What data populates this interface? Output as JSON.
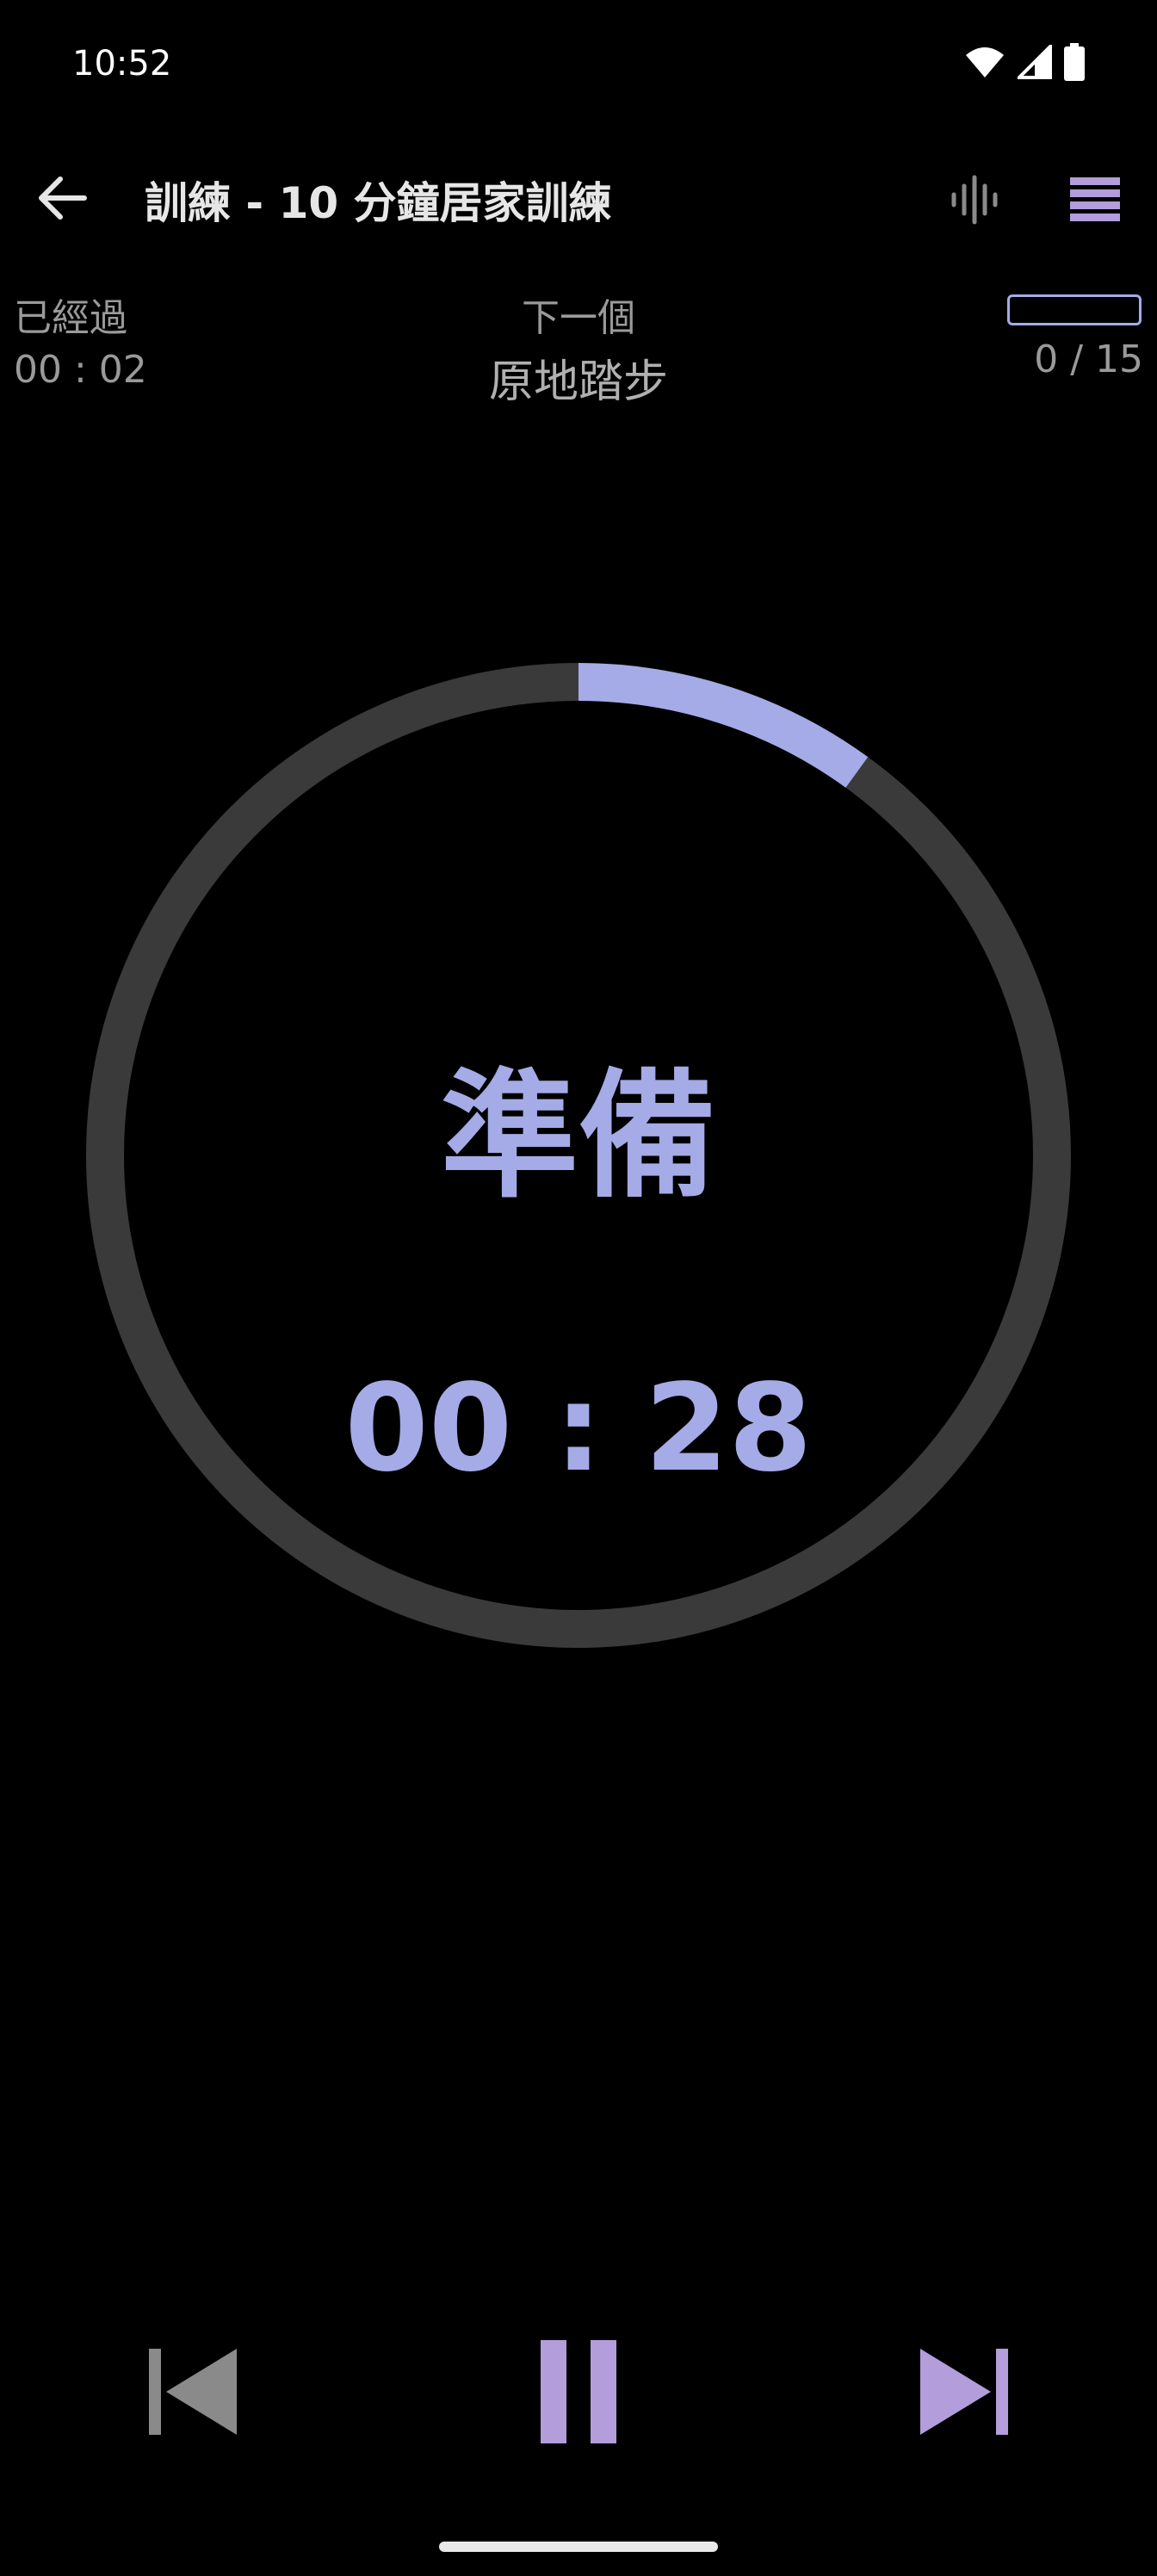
{
  "status_bar": {
    "time": "10:52",
    "icons": [
      "wifi-icon",
      "signal-icon",
      "battery-icon"
    ]
  },
  "app_bar": {
    "title": "訓練 - 10 分鐘居家訓練",
    "icons": [
      "back-arrow-icon",
      "waveform-icon",
      "menu-icon"
    ]
  },
  "info": {
    "elapsed_label": "已經過",
    "elapsed_value": "00 : 02",
    "next_label": "下一個",
    "next_value": "原地踏步",
    "progress_count": "0 / 15",
    "progress_fraction": 0.0
  },
  "timer": {
    "phase": "準備",
    "countdown": "00 : 28",
    "ring_progress_fraction": 0.1
  },
  "controls": {
    "icons": [
      "skip-previous-icon",
      "pause-icon",
      "skip-next-icon"
    ]
  },
  "colors": {
    "accent": "#a4abe6",
    "menu_accent": "#b39ddb",
    "ring_track": "#3a3a3a",
    "muted_text": "#9a9a9a",
    "background": "#000000"
  }
}
